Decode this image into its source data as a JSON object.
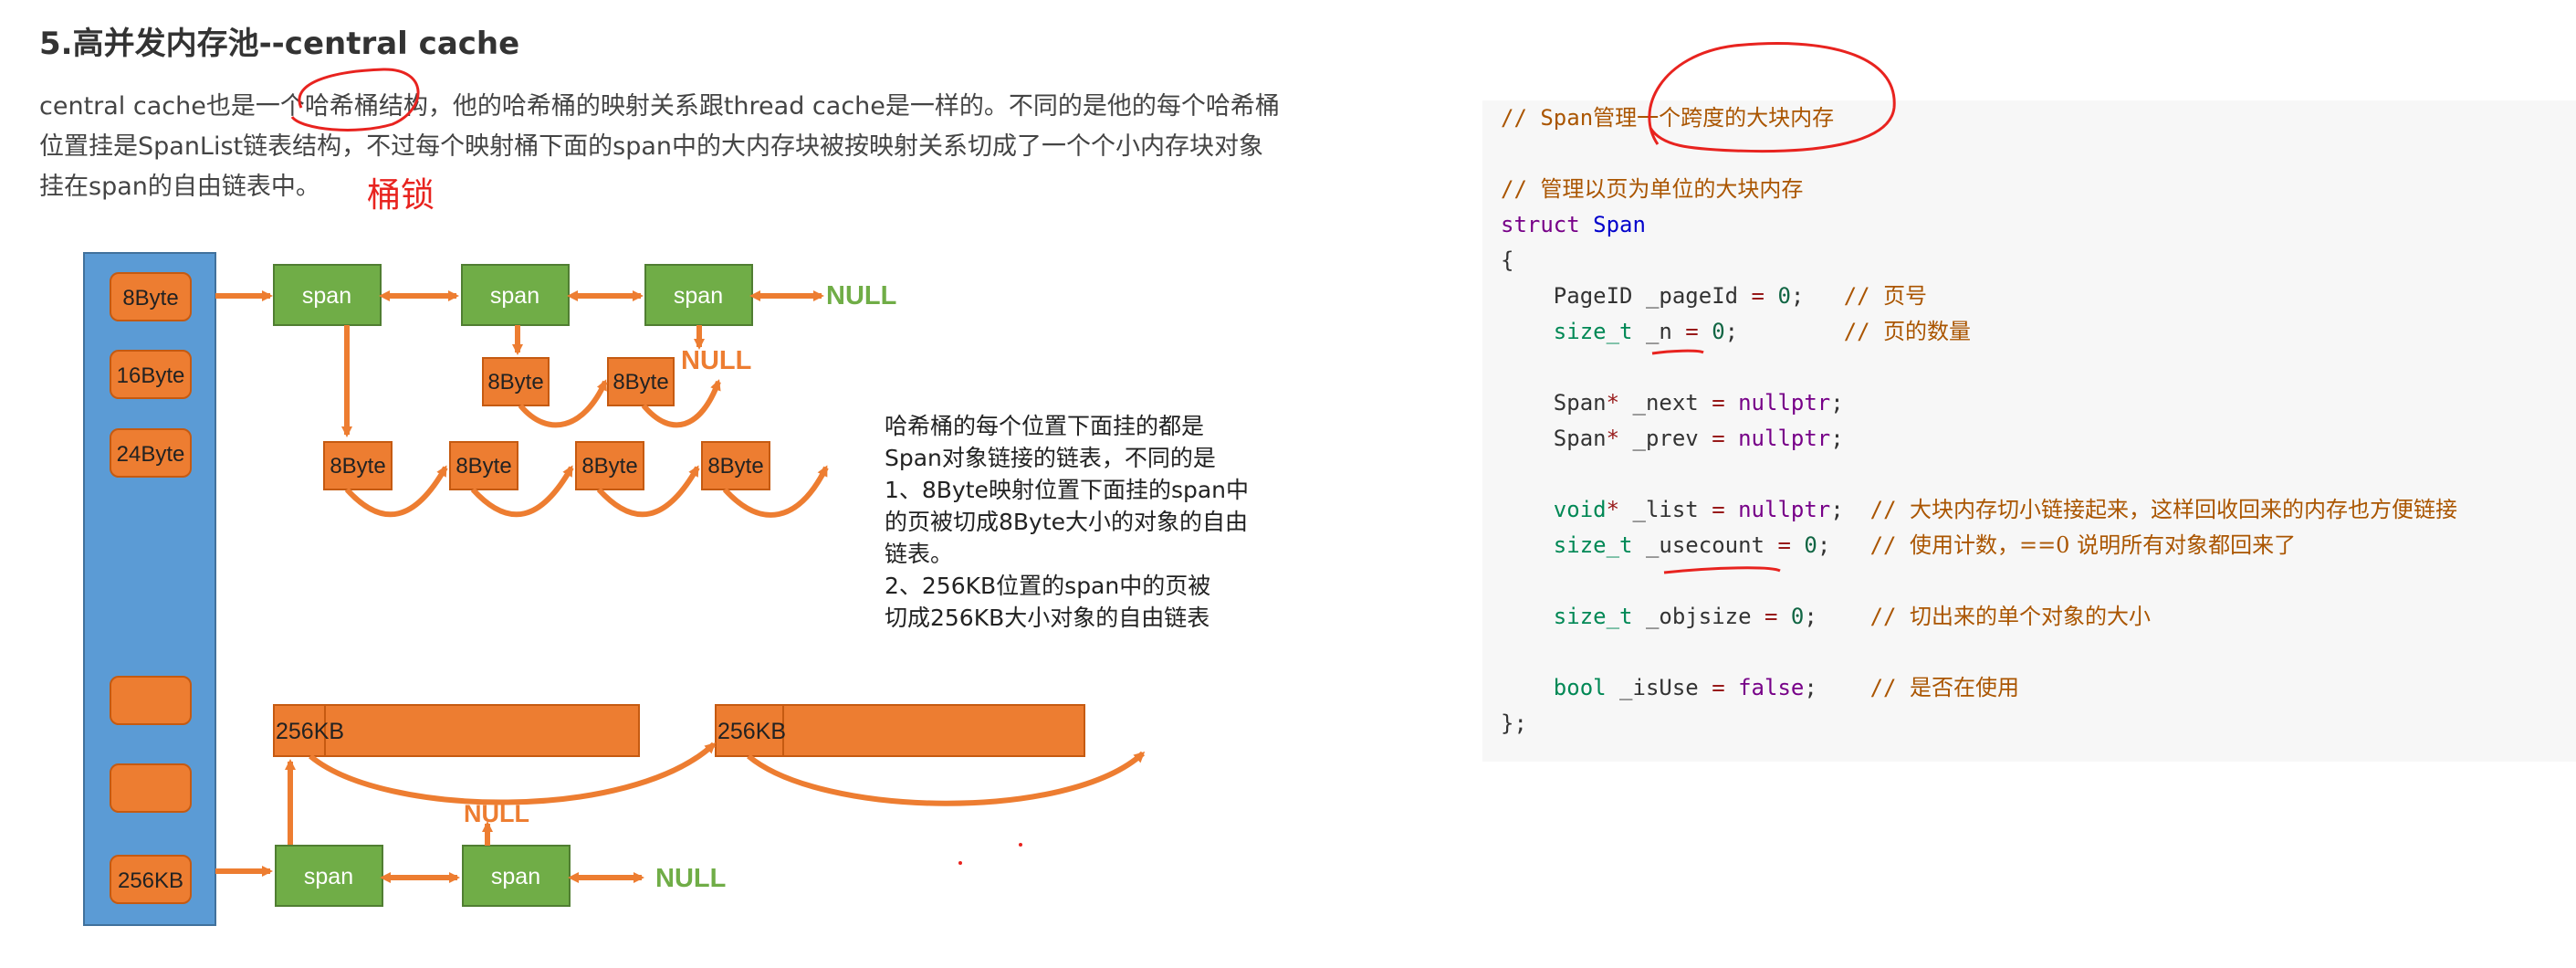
{
  "header": {
    "title": "5.高并发内存池--central cache"
  },
  "intro": {
    "line1_pre": "central cache也是一个",
    "line1_highlight": "哈希桶结构",
    "line1_post": "，他的哈希桶的映射关系跟thread cache是一样的。不同的是他的每个哈希桶",
    "line2": "位置挂是SpanList链表结构，不过每个映射桶下面的span中的大内存块被按映射关系切成了一个个小内存块对象",
    "line3": "挂在span的自由链表中。",
    "handwritten_note": "桶锁"
  },
  "diagram": {
    "buckets": [
      "8Byte",
      "16Byte",
      "24Byte",
      "",
      "",
      "256KB"
    ],
    "top_spans": [
      "span",
      "span",
      "span"
    ],
    "bottom_spans": [
      "span",
      "span"
    ],
    "null_label": "NULL",
    "small_block": "8Byte",
    "big_block": "256KB",
    "note": [
      "哈希桶的每个位置下面挂的都是",
      "Span对象链接的链表，不同的是",
      "1、8Byte映射位置下面挂的span中",
      "的页被切成8Byte大小的对象的自由",
      "链表。",
      "2、256KB位置的span中的页被",
      "切成256KB大小对象的自由链表"
    ],
    "colors": {
      "bucket_bar": "#5b9bd5",
      "block": "#ed7d31",
      "span": "#70ad47",
      "null_text": "#70ad47",
      "null_text_alt": "#ed7d31",
      "annotation": "#e8231f"
    }
  },
  "code": {
    "c1": "// Span",
    "c1zh": "管理一个跨度的大块内存",
    "c2": "// ",
    "c2zh": "管理以页为单位的大块内存",
    "kw_struct": "struct",
    "name": "Span",
    "open": "{",
    "close": "};",
    "f1_type": "PageID",
    "f1_name": " _pageId ",
    "f1_val": "0",
    "f1_cm": "// ",
    "f1_cmzh": "页号",
    "f2_type": "size_t",
    "f2_name": " _n ",
    "f2_val": "0",
    "f2_cm": "// ",
    "f2_cmzh": "页的数量",
    "f3_type": "Span",
    "f3_name": " _next ",
    "f3_val": "nullptr",
    "f4_type": "Span",
    "f4_name": " _prev ",
    "f4_val": "nullptr",
    "f5_type": "void",
    "f5_name": " _list ",
    "f5_val": "nullptr",
    "f5_cm": "// ",
    "f5_cmzh": "大块内存切小链接起来，这样回收回来的内存也方便链接",
    "f6_type": "size_t",
    "f6_name": " _usecount ",
    "f6_val": "0",
    "f6_cm": "// ",
    "f6_cmzh": "使用计数，==0 说明所有对象都回来了",
    "f7_type": "size_t",
    "f7_name": " _objsize ",
    "f7_val": "0",
    "f7_cm": "// ",
    "f7_cmzh": "切出来的单个对象的大小",
    "f8_type": "bool",
    "f8_name": " _isUse ",
    "f8_val": "false",
    "f8_cm": "// ",
    "f8_cmzh": "是否在使用"
  }
}
